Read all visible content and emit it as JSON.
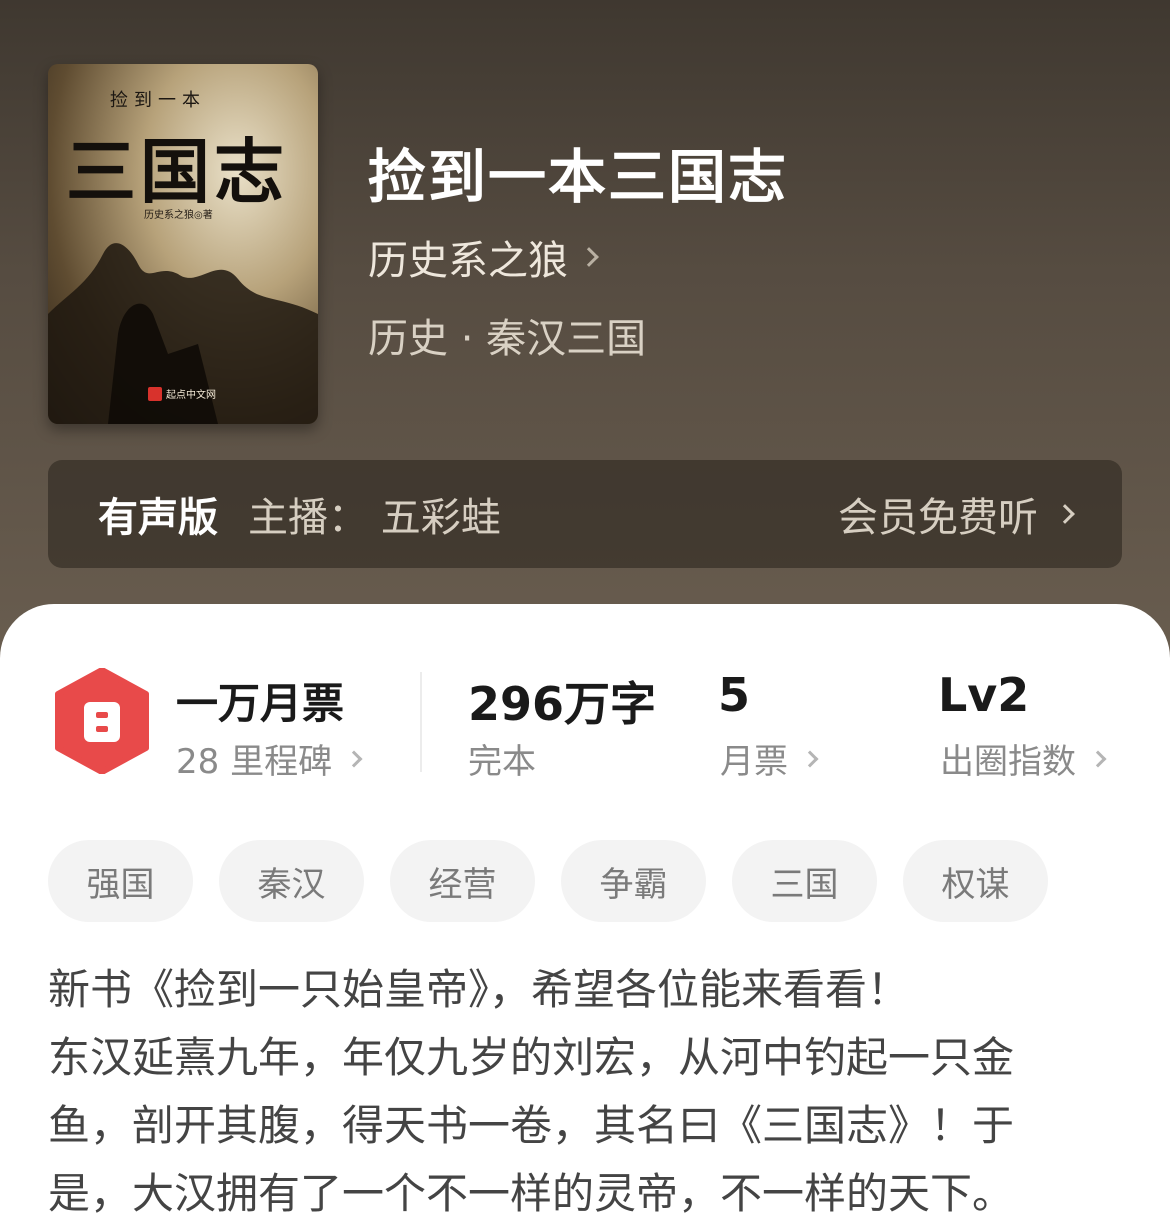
{
  "book": {
    "title": "捡到一本三国志",
    "author": "历史系之狼",
    "category": "历史 · 秦汉三国"
  },
  "cover": {
    "series_text": "捡到一本",
    "title_text": "三国志",
    "author_text": "历史系之狼◎著",
    "publisher_text": "起点中文网"
  },
  "audio": {
    "label": "有声版",
    "narrator": "主播：  五彩蛙",
    "action": "会员免费听"
  },
  "stats": {
    "ticket_title": "一万月票",
    "ticket_sub": "28 里程碑",
    "words_main": "296万字",
    "words_sub": "完本",
    "votes_main": "5",
    "votes_sub": "月票",
    "level_main": "Lv2",
    "level_sub": "出圈指数"
  },
  "tags": [
    "强国",
    "秦汉",
    "经营",
    "争霸",
    "三国",
    "权谋"
  ],
  "description": [
    "新书《捡到一只始皇帝》，希望各位能来看看！",
    "东汉延熹九年，年仅九岁的刘宏，从河中钓起一只金",
    "鱼，剖开其腹，得天书一卷，其名曰《三国志》！于",
    "是，大汉拥有了一个不一样的灵帝，不一样的天下。"
  ],
  "colors": {
    "hero_bg": "#4e463c",
    "ticket_red": "#e84a4a",
    "tag_bg": "#f3f3f3"
  },
  "icons": [
    "chevron-right-icon",
    "ticket-icon"
  ]
}
